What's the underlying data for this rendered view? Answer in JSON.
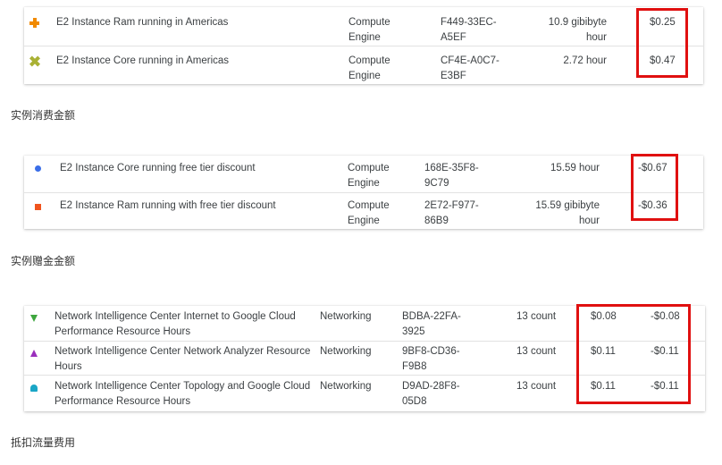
{
  "table1": {
    "rows": [
      {
        "icon": "orange-plus-icon",
        "description": "E2 Instance Ram running in Americas",
        "service_line1": "Compute",
        "service_line2": "Engine",
        "sku_line1": "F449-33EC-",
        "sku_line2": "A5EF",
        "usage_line1": "10.9 gibibyte",
        "usage_line2": "hour",
        "cost": "$0.25"
      },
      {
        "icon": "olive-cross-icon",
        "description": "E2 Instance Core running in Americas",
        "service_line1": "Compute",
        "service_line2": "Engine",
        "sku_line1": "CF4E-A0C7-",
        "sku_line2": "E3BF",
        "usage_line1": "2.72 hour",
        "usage_line2": "",
        "cost": "$0.47"
      }
    ]
  },
  "caption1": "实例消费金额",
  "table2": {
    "rows": [
      {
        "icon": "blue-dot-icon",
        "description": "E2 Instance Core running free tier discount",
        "service_line1": "Compute",
        "service_line2": "Engine",
        "sku_line1": "168E-35F8-",
        "sku_line2": "9C79",
        "usage_line1": "15.59 hour",
        "usage_line2": "",
        "cost": "-$0.67"
      },
      {
        "icon": "orange-square-icon",
        "description": "E2 Instance Ram running with free tier discount",
        "service_line1": "Compute",
        "service_line2": "Engine",
        "sku_line1": "2E72-F977-",
        "sku_line2": "86B9",
        "usage_line1": "15.59 gibibyte",
        "usage_line2": "hour",
        "cost": "-$0.36"
      }
    ]
  },
  "caption2": "实例赠金金额",
  "table3": {
    "rows": [
      {
        "icon": "green-triangle-down-icon",
        "description_line1": "Network Intelligence Center Internet to Google Cloud",
        "description_line2": "Performance Resource Hours",
        "service": "Networking",
        "sku_line1": "BDBA-22FA-",
        "sku_line2": "3925",
        "usage": "13 count",
        "cost": "$0.08",
        "credit": "-$0.08"
      },
      {
        "icon": "purple-triangle-up-icon",
        "description_line1": "Network Intelligence Center Network Analyzer Resource",
        "description_line2": "Hours",
        "service": "Networking",
        "sku_line1": "9BF8-CD36-",
        "sku_line2": "F9B8",
        "usage": "13 count",
        "cost": "$0.11",
        "credit": "-$0.11"
      },
      {
        "icon": "teal-half-circle-icon",
        "description_line1": "Network Intelligence Center Topology and Google Cloud",
        "description_line2": "Performance Resource Hours",
        "service": "Networking",
        "sku_line1": "D9AD-28F8-",
        "sku_line2": "05D8",
        "usage": "13 count",
        "cost": "$0.11",
        "credit": "-$0.11"
      }
    ]
  },
  "caption3": "抵扣流量费用",
  "colors": {
    "highlight": "#e01010",
    "orange": "#f18a00",
    "olive": "#a9b134",
    "blue": "#3a6ee8",
    "red_orange": "#f0541e",
    "green": "#3ea63e",
    "purple": "#9a2fbc",
    "teal": "#1aa6c6"
  }
}
